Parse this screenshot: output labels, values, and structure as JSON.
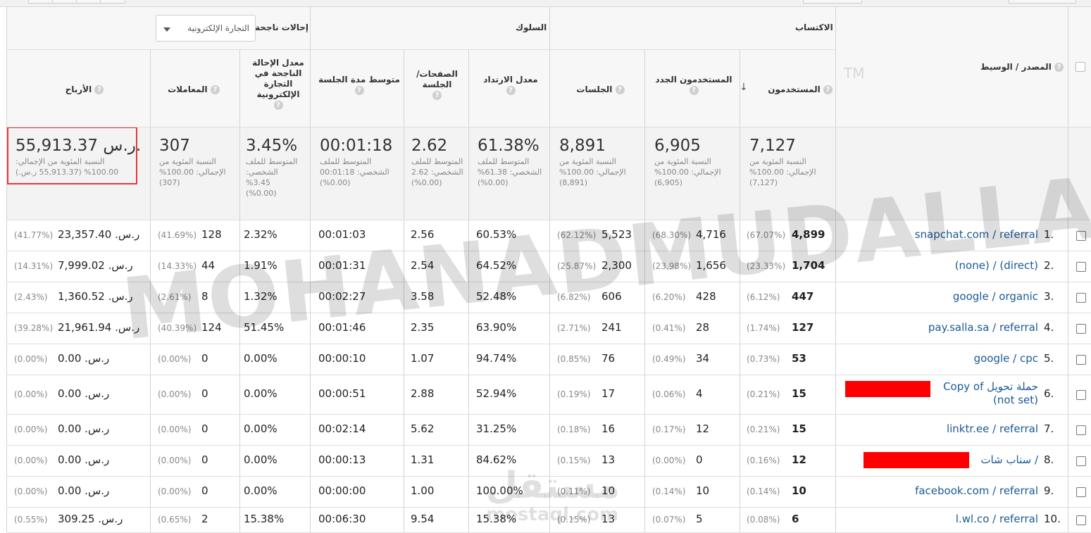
{
  "groups": {
    "acquisition": "الاكتساب",
    "behavior": "السلوك",
    "conversions": "إحالات ناجحة",
    "conversion_select": "التجارة الإلكترونية"
  },
  "columns": {
    "source_medium": "المصدر / الوسيط",
    "users": "المستخدمون",
    "new_users": "المستخدمون الجدد",
    "sessions": "الجلسات",
    "bounce_rate": "معدل الارتداد",
    "pages_per_session": "الصفحات/ الجلسة",
    "avg_session_duration": "متوسط مدة الجلسة",
    "ecom_conversion_rate": "معدل الإحالة الناجحة في التجارة الإلكترونية",
    "transactions": "المعاملات",
    "revenue": "الأرباح"
  },
  "totals": {
    "users": {
      "value": "7,127",
      "sub": "النسبة المئوية من الإجمالي: 100.00% (7,127)"
    },
    "new_users": {
      "value": "6,905",
      "sub": "النسبة المئوية من الإجمالي: 100.00% (6,905)"
    },
    "sessions": {
      "value": "8,891",
      "sub": "النسبة المئوية من الإجمالي: 100.00% (8,891)"
    },
    "bounce_rate": {
      "value": "61.38%",
      "sub": "المتوسط للملف الشخصي: 61.38% (0.00%)"
    },
    "pages_per_session": {
      "value": "2.62",
      "sub": "المتوسط للملف الشخصي: 2.62 (0.00%)"
    },
    "avg_session_duration": {
      "value": "00:01:18",
      "sub": "المتوسط للملف الشخصي: 00:01:18 (0.00%)"
    },
    "ecom_conversion_rate": {
      "value": "3.45%",
      "sub": "المتوسط للملف الشخصي: 3.45% (0.00%)"
    },
    "transactions": {
      "value": "307",
      "sub": "النسبة المئوية من الإجمالي: 100.00% (307)"
    },
    "revenue": {
      "value": "55,913.37 ر.س.",
      "sub": "النسبة المئوية من الإجمالي: 100.00% (55,913.37 ر.س.)"
    }
  },
  "watermark": {
    "main": "MOHANADMUDALLALA",
    "logo": "مستقل",
    "logo_url": "mostaql.com"
  },
  "tm": "TM",
  "rows": [
    {
      "n": "1.",
      "src": "snapchat.com / referral",
      "users": "4,899",
      "users_pct": "(67.07%)",
      "new": "4,716",
      "new_pct": "(68.30%)",
      "sess": "5,523",
      "sess_pct": "(62.12%)",
      "bounce": "60.53%",
      "pps": "2.56",
      "dur": "00:01:03",
      "conv": "2.32%",
      "tx": "128",
      "tx_pct": "(41.69%)",
      "rev": "ر.س. 23,357.40",
      "rev_pct": "(41.77%)"
    },
    {
      "n": "2.",
      "src": "(none) / (direct)",
      "users": "1,704",
      "users_pct": "(23.33%)",
      "new": "1,656",
      "new_pct": "(23.98%)",
      "sess": "2,300",
      "sess_pct": "(25.87%)",
      "bounce": "64.52%",
      "pps": "2.54",
      "dur": "00:01:31",
      "conv": "1.91%",
      "tx": "44",
      "tx_pct": "(14.33%)",
      "rev": "ر.س. 7,999.02",
      "rev_pct": "(14.31%)"
    },
    {
      "n": "3.",
      "src": "google / organic",
      "users": "447",
      "users_pct": "(6.12%)",
      "new": "428",
      "new_pct": "(6.20%)",
      "sess": "606",
      "sess_pct": "(6.82%)",
      "bounce": "52.48%",
      "pps": "3.58",
      "dur": "00:02:27",
      "conv": "1.32%",
      "tx": "8",
      "tx_pct": "(2.61%)",
      "rev": "ر.س. 1,360.52",
      "rev_pct": "(2.43%)"
    },
    {
      "n": "4.",
      "src": "pay.salla.sa / referral",
      "users": "127",
      "users_pct": "(1.74%)",
      "new": "28",
      "new_pct": "(0.41%)",
      "sess": "241",
      "sess_pct": "(2.71%)",
      "bounce": "63.90%",
      "pps": "2.35",
      "dur": "00:01:46",
      "conv": "51.45%",
      "tx": "124",
      "tx_pct": "(40.39%)",
      "rev": "ر.س. 21,961.94",
      "rev_pct": "(39.28%)"
    },
    {
      "n": "5.",
      "src": "google / cpc",
      "users": "53",
      "users_pct": "(0.73%)",
      "new": "34",
      "new_pct": "(0.49%)",
      "sess": "76",
      "sess_pct": "(0.85%)",
      "bounce": "94.74%",
      "pps": "1.07",
      "dur": "00:00:10",
      "conv": "0.00%",
      "tx": "0",
      "tx_pct": "(0.00%)",
      "rev": "ر.س. 0.00",
      "rev_pct": "(0.00%)"
    },
    {
      "n": "6.",
      "src": "Copy of حملة تحويل",
      "src2": "(not set)",
      "users": "15",
      "users_pct": "(0.21%)",
      "new": "4",
      "new_pct": "(0.06%)",
      "sess": "17",
      "sess_pct": "(0.19%)",
      "bounce": "52.94%",
      "pps": "2.88",
      "dur": "00:00:51",
      "conv": "0.00%",
      "tx": "0",
      "tx_pct": "(0.00%)",
      "rev": "ر.س. 0.00",
      "rev_pct": "(0.00%)"
    },
    {
      "n": "7.",
      "src": "linktr.ee / referral",
      "users": "15",
      "users_pct": "(0.21%)",
      "new": "12",
      "new_pct": "(0.17%)",
      "sess": "16",
      "sess_pct": "(0.18%)",
      "bounce": "31.25%",
      "pps": "5.62",
      "dur": "00:02:14",
      "conv": "0.00%",
      "tx": "0",
      "tx_pct": "(0.00%)",
      "rev": "ر.س. 0.00",
      "rev_pct": "(0.00%)"
    },
    {
      "n": "8.",
      "src": "سناب شات /",
      "users": "12",
      "users_pct": "(0.16%)",
      "new": "0",
      "new_pct": "(0.00%)",
      "sess": "13",
      "sess_pct": "(0.15%)",
      "bounce": "84.62%",
      "pps": "1.31",
      "dur": "00:00:13",
      "conv": "0.00%",
      "tx": "0",
      "tx_pct": "(0.00%)",
      "rev": "ر.س. 0.00",
      "rev_pct": "(0.00%)"
    },
    {
      "n": "9.",
      "src": "facebook.com / referral",
      "users": "10",
      "users_pct": "(0.14%)",
      "new": "10",
      "new_pct": "(0.14%)",
      "sess": "10",
      "sess_pct": "(0.11%)",
      "bounce": "100.00%",
      "pps": "1.00",
      "dur": "00:00:00",
      "conv": "0.00%",
      "tx": "0",
      "tx_pct": "(0.00%)",
      "rev": "ر.س. 0.00",
      "rev_pct": "(0.00%)"
    },
    {
      "n": "10.",
      "src": "l.wl.co / referral",
      "users": "6",
      "users_pct": "(0.08%)",
      "new": "5",
      "new_pct": "(0.07%)",
      "sess": "13",
      "sess_pct": "(0.15%)",
      "bounce": "15.38%",
      "pps": "9.54",
      "dur": "00:06:30",
      "conv": "15.38%",
      "tx": "2",
      "tx_pct": "(0.65%)",
      "rev": "ر.س. 309.25",
      "rev_pct": "(0.55%)"
    }
  ],
  "icons": {
    "help": "?",
    "sort": "↓"
  }
}
